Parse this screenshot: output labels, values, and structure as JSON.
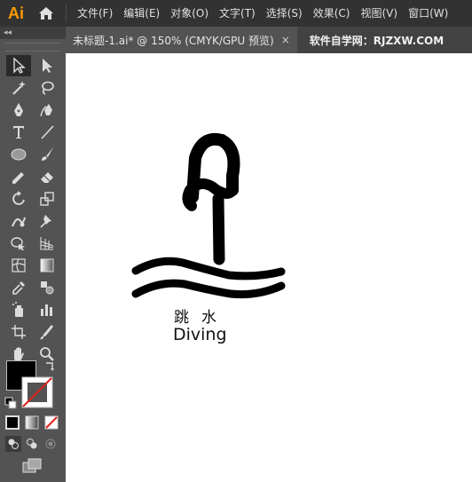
{
  "app": {
    "logo": "Ai"
  },
  "menu": [
    "文件(F)",
    "编辑(E)",
    "对象(O)",
    "文字(T)",
    "选择(S)",
    "效果(C)",
    "视图(V)",
    "窗口(W)"
  ],
  "tab": {
    "title": "未标题-1.ai* @ 150% (CMYK/GPU 预览)",
    "close": "×"
  },
  "watermark": "软件自学网：RJZXW.COM",
  "panel": {
    "collapse": "◂◂"
  },
  "artwork": {
    "label_cn": "跳水",
    "label_en": "Diving"
  },
  "colors": {
    "menubar": "#323232",
    "panel": "#535353",
    "canvas": "#ffffff",
    "accent": "#ff9a00"
  }
}
